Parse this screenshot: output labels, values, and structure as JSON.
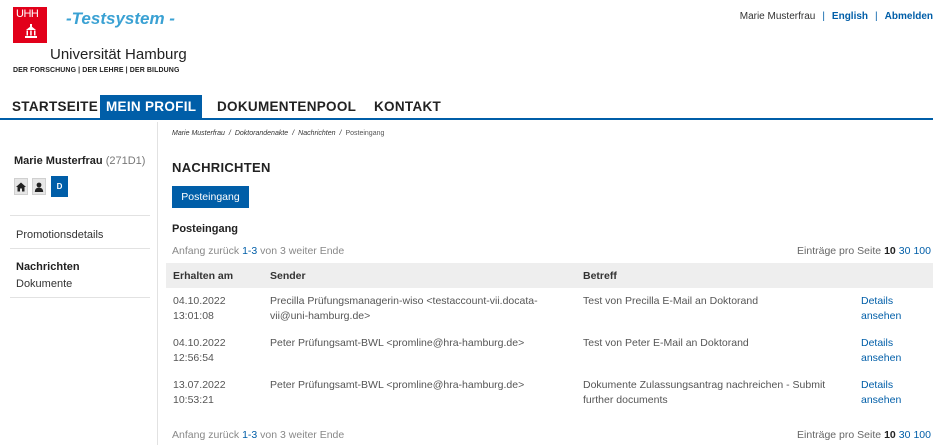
{
  "header": {
    "logo_text": "UHH",
    "system_name": "-Testsystem -",
    "university": "Universität Hamburg",
    "tagline": "DER FORSCHUNG | DER LEHRE | DER BILDUNG",
    "user": "Marie Musterfrau",
    "sep": "|",
    "language": "English",
    "logout": "Abmelden"
  },
  "nav": {
    "items": [
      {
        "label": "STARTSEITE"
      },
      {
        "label": "MEIN PROFIL"
      },
      {
        "label": "DOKUMENTENPOOL"
      },
      {
        "label": "KONTAKT"
      }
    ]
  },
  "breadcrumb": {
    "items": [
      "Marie Musterfrau",
      "Doktorandenakte",
      "Nachrichten"
    ],
    "separator": "/",
    "current": "Posteingang"
  },
  "sidebar": {
    "user_name": "Marie Musterfrau",
    "user_id": "(271D1)",
    "icons": [
      "home-icon",
      "person-icon"
    ],
    "d_label": "D",
    "links": [
      "Promotionsdetails",
      "Nachrichten",
      "Dokumente"
    ]
  },
  "content": {
    "title": "NACHRICHTEN",
    "tab_label": "Posteingang",
    "section_title": "Posteingang",
    "pager": {
      "first": "Anfang",
      "prev": "zurück",
      "count": "1-3",
      "of": "von 3",
      "next": "weiter",
      "last": "Ende"
    },
    "per_page": {
      "label": "Einträge pro Seite",
      "current": "10",
      "opt2": "30",
      "opt3": "100"
    },
    "table": {
      "columns": [
        "Erhalten am",
        "Sender",
        "Betreff",
        ""
      ],
      "rows": [
        {
          "date": "04.10.2022",
          "time": "13:01:08",
          "sender_l1": "Precilla Prüfungsmanagerin-wiso <testaccount-vii.docata-",
          "sender_l2": "vii@uni-hamburg.de>",
          "subject_l1": "Test von Precilla E-Mail an Doktorand",
          "subject_l2": "",
          "link_l1": "Details",
          "link_l2": "ansehen"
        },
        {
          "date": "04.10.2022",
          "time": "12:56:54",
          "sender_l1": "Peter Prüfungsamt-BWL <promline@hra-hamburg.de>",
          "sender_l2": "",
          "subject_l1": "Test von Peter E-Mail an Doktorand",
          "subject_l2": "",
          "link_l1": "Details",
          "link_l2": "ansehen"
        },
        {
          "date": "13.07.2022",
          "time": "10:53:21",
          "sender_l1": "Peter Prüfungsamt-BWL <promline@hra-hamburg.de>",
          "sender_l2": "",
          "subject_l1": "Dokumente Zulassungsantrag nachreichen - Submit",
          "subject_l2": "further documents",
          "link_l1": "Details",
          "link_l2": "ansehen"
        }
      ]
    }
  },
  "colors": {
    "brand_red": "#e2001a",
    "accent_blue": "#005ea8",
    "system_cyan": "#3aa1d3"
  }
}
